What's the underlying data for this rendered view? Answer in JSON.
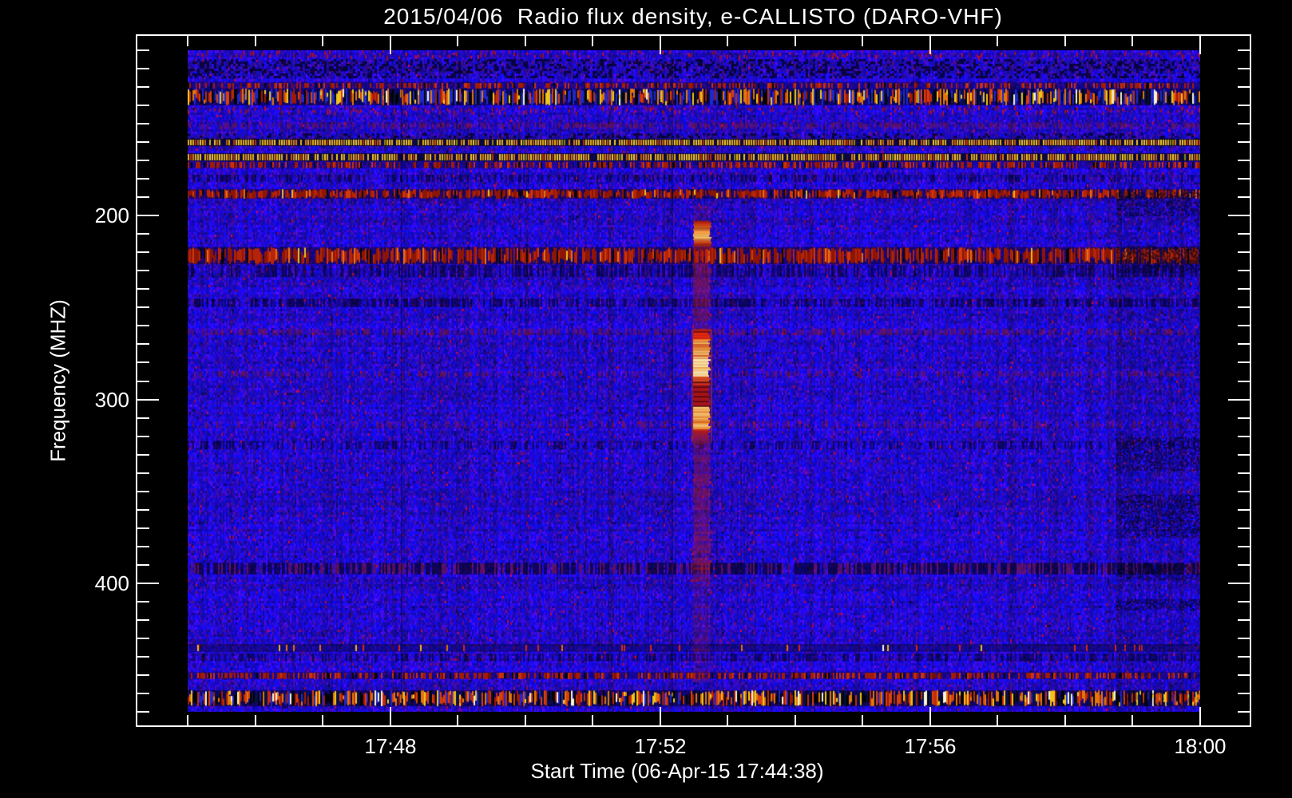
{
  "chart_data": {
    "type": "heatmap",
    "subtype": "radio-spectrogram",
    "title": "2015/04/06  Radio flux density, e-CALLISTO (DARO-VHF)",
    "instrument": "e-CALLISTO (DARO-VHF)",
    "date": "2015/04/06",
    "xlabel": "Start Time (06-Apr-15 17:44:38)",
    "ylabel": "Frequency (MHZ)",
    "x_axis": {
      "label": "Start Time (06-Apr-15 17:44:38)",
      "start_time": "17:45",
      "end_time": "18:00",
      "minor_count": 16,
      "major": [
        {
          "label": "17:48",
          "frac": 0.2
        },
        {
          "label": "17:52",
          "frac": 0.4667
        },
        {
          "label": "17:56",
          "frac": 0.7333
        },
        {
          "label": "18:00",
          "frac": 1.0
        }
      ]
    },
    "y_axis": {
      "label": "Frequency (MHZ)",
      "top_mhz": 110,
      "bottom_mhz": 470,
      "minor_step_mhz": 10,
      "minor_count": 37,
      "major": [
        {
          "label": "200",
          "frac": 0.25
        },
        {
          "label": "300",
          "frac": 0.5278
        },
        {
          "label": "400",
          "frac": 0.8056
        }
      ]
    },
    "palette": {
      "background": "#000000",
      "base_blue": "#1c1ccd",
      "text": "#ffffff",
      "burst_red": "#c42408",
      "burst_yellow": "#ffd98c",
      "rfi_yellow": "#eec41e",
      "rfi_orange": "#e0760f"
    },
    "features": {
      "bands": [
        {
          "y0": 0.0,
          "y1": 0.013,
          "kind": "red_flecks",
          "density": 0.25
        },
        {
          "y0": 0.013,
          "y1": 0.04,
          "kind": "dark_mottle",
          "density": 0.35
        },
        {
          "y0": 0.048,
          "y1": 0.058,
          "kind": "red_speckle",
          "density": 0.45
        },
        {
          "y0": 0.058,
          "y1": 0.083,
          "kind": "rfi_heavy",
          "density": 1.0
        },
        {
          "y0": 0.083,
          "y1": 0.098,
          "kind": "red_flecks",
          "density": 0.35
        },
        {
          "y0": 0.108,
          "y1": 0.12,
          "kind": "faint_red_speckle",
          "density": 0.5
        },
        {
          "y0": 0.126,
          "y1": 0.134,
          "kind": "dark_mottle",
          "density": 0.25
        },
        {
          "y0": 0.134,
          "y1": 0.145,
          "kind": "dashed_yellow",
          "density": 0.85
        },
        {
          "y0": 0.156,
          "y1": 0.168,
          "kind": "dashed_yellow",
          "density": 0.85
        },
        {
          "y0": 0.168,
          "y1": 0.179,
          "kind": "red_speckle",
          "density": 0.5
        },
        {
          "y0": 0.188,
          "y1": 0.199,
          "kind": "dark_speckle",
          "density": 0.35
        },
        {
          "y0": 0.21,
          "y1": 0.224,
          "kind": "red_speckle_strong",
          "density": 0.8
        },
        {
          "y0": 0.298,
          "y1": 0.323,
          "kind": "red_speckle_strong",
          "density": 0.8
        },
        {
          "y0": 0.325,
          "y1": 0.342,
          "kind": "dark_speckle",
          "density": 0.45
        },
        {
          "y0": 0.375,
          "y1": 0.388,
          "kind": "dark_speckle",
          "density": 0.5
        },
        {
          "y0": 0.42,
          "y1": 0.432,
          "kind": "faint_red_speckle",
          "density": 0.45
        },
        {
          "y0": 0.484,
          "y1": 0.495,
          "kind": "faint_red_speckle",
          "density": 0.35
        },
        {
          "y0": 0.56,
          "y1": 0.572,
          "kind": "faint_red_speckle",
          "density": 0.3
        },
        {
          "y0": 0.591,
          "y1": 0.603,
          "kind": "dark_speckle",
          "density": 0.3
        },
        {
          "y0": 0.775,
          "y1": 0.792,
          "kind": "dark_red_speckle",
          "density": 0.55
        },
        {
          "y0": 0.898,
          "y1": 0.91,
          "kind": "sparse_dots",
          "density": 0.09
        },
        {
          "y0": 0.912,
          "y1": 0.924,
          "kind": "dark_speckle",
          "density": 0.4
        },
        {
          "y0": 0.94,
          "y1": 0.951,
          "kind": "red_speckle",
          "density": 0.55
        },
        {
          "y0": 0.968,
          "y1": 0.991,
          "kind": "rfi_bottom",
          "density": 1.0
        }
      ],
      "vertical_dark_lines": [
        {
          "x": 0.211,
          "alpha": 0.4
        },
        {
          "x": 0.479,
          "alpha": 0.38
        },
        {
          "x": 0.722,
          "alpha": 0.2
        }
      ],
      "right_dark_column": {
        "x0": 0.917,
        "tint_alpha": 0.25,
        "patches": [
          [
            0.215,
            0.25
          ],
          [
            0.295,
            0.335
          ],
          [
            0.585,
            0.635
          ],
          [
            0.672,
            0.736
          ],
          [
            0.777,
            0.8
          ],
          [
            0.83,
            0.845
          ]
        ]
      },
      "burst": {
        "time_approx": "17:52:30",
        "x_center": 0.508,
        "half_width": 11,
        "weak_column": {
          "y0": 0.235,
          "y1": 0.955
        },
        "blob": {
          "y0": 0.258,
          "y1": 0.296
        },
        "segments": [
          {
            "y0": 0.422,
            "y1": 0.437,
            "style": "red"
          },
          {
            "y0": 0.437,
            "y1": 0.467,
            "style": "orange_yellow"
          },
          {
            "y0": 0.467,
            "y1": 0.493,
            "style": "bright_yellow"
          },
          {
            "y0": 0.493,
            "y1": 0.501,
            "style": "orange_red"
          },
          {
            "y0": 0.501,
            "y1": 0.539,
            "style": "red_striated"
          },
          {
            "y0": 0.539,
            "y1": 0.573,
            "style": "orange_yellow"
          },
          {
            "y0": 0.573,
            "y1": 0.593,
            "style": "red_fade"
          }
        ]
      }
    }
  }
}
